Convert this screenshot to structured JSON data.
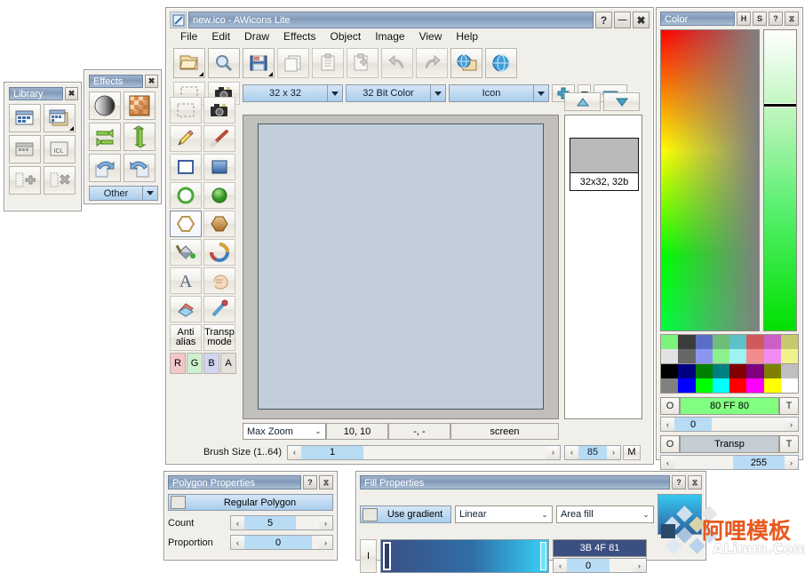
{
  "app": {
    "title": "new.ico - AWicons Lite",
    "icon": "pencil-icon",
    "titlebar_buttons": [
      {
        "name": "help-button",
        "label": "?"
      },
      {
        "name": "minimize-button",
        "label": "—"
      },
      {
        "name": "close-button",
        "label": "✖"
      }
    ]
  },
  "menu": {
    "items": [
      "File",
      "Edit",
      "Draw",
      "Effects",
      "Object",
      "Image",
      "View",
      "Help"
    ]
  },
  "toolbar": {
    "buttons": [
      {
        "name": "open-file-button",
        "icon": "folder-open-icon",
        "dropdown": true
      },
      {
        "name": "preview-button",
        "icon": "magnifier-icon",
        "dropdown": false
      },
      {
        "name": "save-button",
        "icon": "floppy-disk-icon",
        "dropdown": true
      },
      {
        "name": "copy-button",
        "icon": "copy-icon",
        "dropdown": false
      },
      {
        "name": "paste-button",
        "icon": "clipboard-icon",
        "dropdown": false
      },
      {
        "name": "paste-new-button",
        "icon": "clipboard-plus-icon",
        "dropdown": false
      },
      {
        "name": "undo-button",
        "icon": "undo-arrow-icon",
        "dropdown": false
      },
      {
        "name": "redo-button",
        "icon": "redo-arrow-icon",
        "dropdown": false
      },
      {
        "name": "export-web-button",
        "icon": "globe-folder-icon",
        "dropdown": false
      },
      {
        "name": "web-button",
        "icon": "globe-icon",
        "dropdown": false
      }
    ]
  },
  "options_bar": {
    "select_all_button": {
      "name": "selection-button",
      "icon": "marquee-icon"
    },
    "capture_button": {
      "name": "screen-capture-button",
      "icon": "camera-icon"
    },
    "size_combo": {
      "name": "image-size-combo",
      "value": "32 x 32"
    },
    "depth_combo": {
      "name": "color-depth-combo",
      "value": "32 Bit Color"
    },
    "type_combo": {
      "name": "image-type-combo",
      "value": "Icon"
    },
    "add_button": {
      "name": "add-image-button",
      "icon": "plus-icon"
    },
    "add_dropdown": {
      "name": "add-image-dropdown",
      "icon": "chevron-down-icon"
    },
    "remove_button": {
      "name": "remove-image-button",
      "icon": "minus-icon"
    },
    "move_up_button": {
      "name": "move-up-button",
      "icon": "triangle-up-icon"
    },
    "move_down_button": {
      "name": "move-down-button",
      "icon": "triangle-down-icon"
    }
  },
  "tools": {
    "rows": [
      [
        {
          "name": "tool-select",
          "icon": "marquee-icon"
        },
        {
          "name": "tool-capture",
          "icon": "camera-icon"
        }
      ],
      [
        {
          "name": "tool-pencil",
          "icon": "pencil-icon"
        },
        {
          "name": "tool-line",
          "icon": "line-icon"
        }
      ],
      [
        {
          "name": "tool-rectangle",
          "icon": "rectangle-outline-icon"
        },
        {
          "name": "tool-rectangle-filled",
          "icon": "rectangle-filled-icon"
        }
      ],
      [
        {
          "name": "tool-ellipse",
          "icon": "ellipse-outline-icon"
        },
        {
          "name": "tool-ellipse-filled",
          "icon": "ellipse-filled-icon"
        }
      ],
      [
        {
          "name": "tool-polygon",
          "icon": "polygon-outline-icon",
          "selected": true
        },
        {
          "name": "tool-polygon-filled",
          "icon": "polygon-filled-icon"
        }
      ],
      [
        {
          "name": "tool-fill",
          "icon": "paint-bucket-icon"
        },
        {
          "name": "tool-replace-color",
          "icon": "color-swirl-icon"
        }
      ],
      [
        {
          "name": "tool-text",
          "icon": "text-a-icon"
        },
        {
          "name": "tool-smudge",
          "icon": "hand-icon"
        }
      ],
      [
        {
          "name": "tool-eraser",
          "icon": "eraser-icon"
        },
        {
          "name": "tool-picker",
          "icon": "eyedropper-icon"
        }
      ]
    ],
    "antialias_label": "Anti\nalias",
    "antialias_line1": "Anti",
    "antialias_line2": "alias",
    "transp_line1": "Transp",
    "transp_line2": "mode",
    "channels": [
      {
        "name": "channel-r",
        "label": "R",
        "color": "#f2c7c7"
      },
      {
        "name": "channel-g",
        "label": "G",
        "color": "#cdf0cd"
      },
      {
        "name": "channel-b",
        "label": "B",
        "color": "#d2d4f4"
      },
      {
        "name": "channel-a",
        "label": "A",
        "color": "#e3e1db"
      }
    ]
  },
  "statusbar": {
    "zoom_combo": "Max Zoom",
    "coords": "10, 10",
    "coords2": "-, -",
    "mode": "screen",
    "brush_label": "Brush Size (1..64)",
    "brush_value": "1",
    "right_value": "85",
    "m_button": "M"
  },
  "imagelist": {
    "thumb_label": "32x32, 32b"
  },
  "color_panel": {
    "title": "Color",
    "buttons": [
      {
        "name": "hue-mode-button",
        "label": "H"
      },
      {
        "name": "saturation-mode-button",
        "label": "S"
      },
      {
        "name": "color-help-button",
        "label": "?"
      },
      {
        "name": "color-collapse-button",
        "label": "⧖"
      }
    ],
    "foreground": {
      "name": "foreground-color",
      "value": "80 FF 80",
      "hex": "#80FF80",
      "left_button": "O",
      "right_button": "T",
      "alpha": "0"
    },
    "background": {
      "name": "background-color",
      "value": "Transp",
      "left_button": "O",
      "right_button": "T",
      "alpha": "255"
    },
    "swatches_row1": [
      "#7cf37c",
      "#3c3c3c",
      "#5a6ec8",
      "#6fbe78",
      "#5ec0c8",
      "#d05a5a",
      "#cc5ec8",
      "#c8c86e"
    ],
    "swatches_row2": [
      "#e2e2e2",
      "#676767",
      "#8c96f0",
      "#8cf08c",
      "#9ef2f2",
      "#f28c8c",
      "#f08cf0",
      "#f2f28c"
    ],
    "swatches_row3": [
      "#000000",
      "#000080",
      "#008000",
      "#008080",
      "#800000",
      "#800080",
      "#808000",
      "#c0c0c0"
    ],
    "swatches_row4": [
      "#808080",
      "#0000ff",
      "#00ff00",
      "#00ffff",
      "#ff0000",
      "#ff00ff",
      "#ffff00",
      "#ffffff"
    ]
  },
  "library_panel": {
    "title": "Library",
    "close_button": "✖",
    "buttons": [
      {
        "name": "library-open-icon",
        "icon": "library-window-icon"
      },
      {
        "name": "library-open-multi-icon",
        "icon": "library-windows-icon",
        "dropdown": true
      },
      {
        "name": "library-save-icon",
        "icon": "library-save-icon"
      },
      {
        "name": "library-icl-icon",
        "icon": "icl-file-icon"
      },
      {
        "name": "library-add-icon",
        "icon": "library-add-icon"
      },
      {
        "name": "library-delete-icon",
        "icon": "library-delete-icon"
      }
    ]
  },
  "effects_panel": {
    "title": "Effects",
    "close_button": "✖",
    "buttons": [
      {
        "name": "effect-shade-icon",
        "icon": "sphere-shade-icon"
      },
      {
        "name": "effect-checker-icon",
        "icon": "checker-gradient-icon"
      },
      {
        "name": "effect-flip-horizontal-icon",
        "icon": "flip-horizontal-icon"
      },
      {
        "name": "effect-flip-vertical-icon",
        "icon": "flip-vertical-icon"
      },
      {
        "name": "effect-rotate-left-icon",
        "icon": "rotate-left-icon"
      },
      {
        "name": "effect-rotate-right-icon",
        "icon": "rotate-right-icon"
      }
    ],
    "other_combo": "Other"
  },
  "polygon_panel": {
    "title": "Polygon Properties",
    "help_button": "?",
    "collapse_button": "⧖",
    "regular_polygon_label": "Regular Polygon",
    "count_label": "Count",
    "count_value": "5",
    "proportion_label": "Proportion",
    "proportion_value": "0"
  },
  "fill_panel": {
    "title": "Fill Properties",
    "help_button": "?",
    "collapse_button": "⧖",
    "use_gradient_label": "Use gradient",
    "gradient_type": "Linear",
    "fill_mode": "Area fill",
    "gradient_start": "#3B4F81",
    "gradient_end": "#35c8f0",
    "color_value": "3B 4F 81",
    "color_alpha": "0",
    "text_button": "I"
  },
  "watermark": {
    "cn_text": "阿哩模板",
    "en_text": "ALimm.Com"
  }
}
